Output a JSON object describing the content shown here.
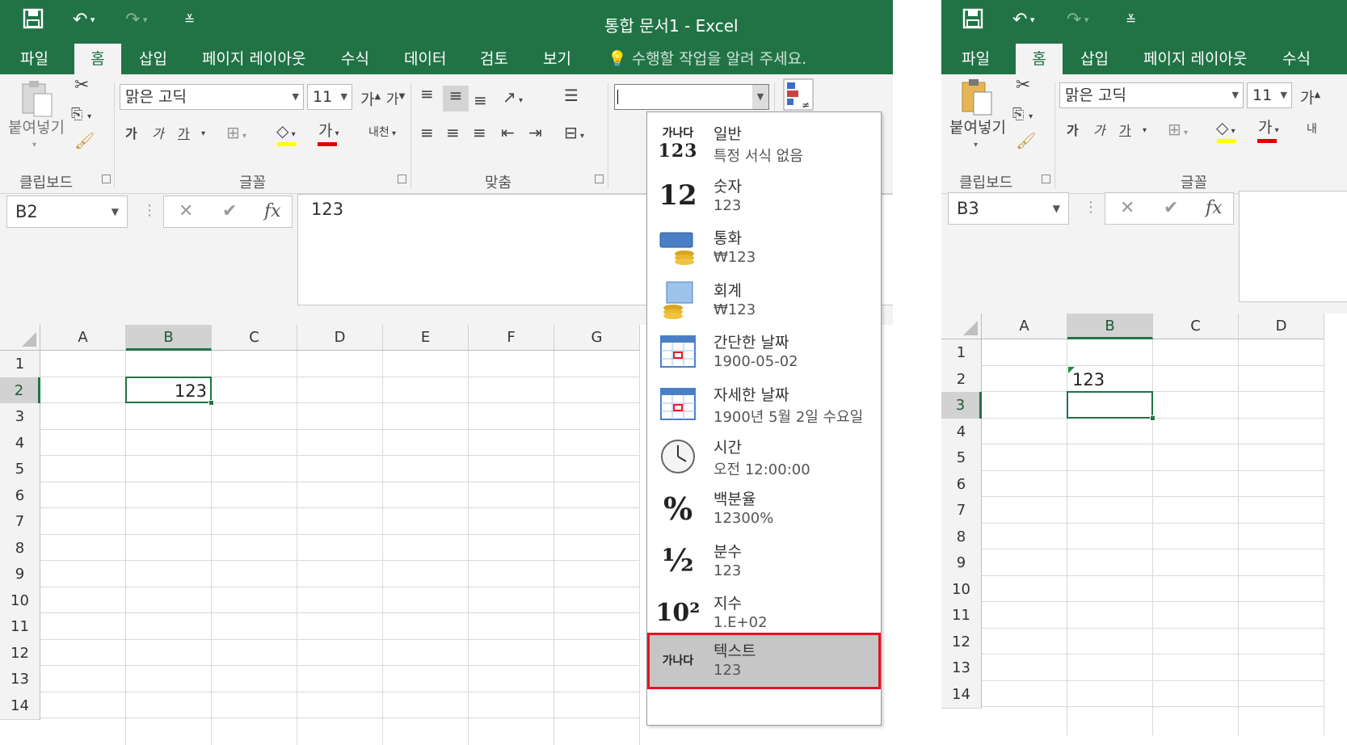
{
  "left": {
    "window_title": "통합 문서1 - Excel",
    "tabs": [
      "파일",
      "홈",
      "삽입",
      "페이지 레이아웃",
      "수식",
      "데이터",
      "검토",
      "보기"
    ],
    "tell_me": "수행할 작업을 알려 주세요.",
    "ribbon": {
      "paste_label": "붙여넣기",
      "font_name": "맑은 고딕",
      "font_size": "11",
      "bold": "가",
      "italic": "가",
      "underline": "가",
      "grow_font": "가",
      "shrink_font": "가",
      "font_color": "가",
      "wrap_text": "내천",
      "groups": {
        "clipboard": "클립보드",
        "font": "글꼴",
        "alignment": "맞춤"
      },
      "number_format_value": ""
    },
    "name_box": "B2",
    "formula": "123",
    "columns": [
      "A",
      "B",
      "C",
      "D",
      "E",
      "F",
      "G"
    ],
    "rows": [
      "1",
      "2",
      "3",
      "4",
      "5",
      "6",
      "7",
      "8",
      "9",
      "10",
      "11",
      "12",
      "13",
      "14"
    ],
    "cell_B2": "123",
    "number_formats": [
      {
        "name": "일반",
        "example": "특정 서식 없음",
        "icon": "general-icon",
        "icon_text": "가나다",
        "icon_text2": "123"
      },
      {
        "name": "숫자",
        "example": "123",
        "icon": "number-icon",
        "icon_text": "12"
      },
      {
        "name": "통화",
        "example": "₩123",
        "icon": "currency-icon"
      },
      {
        "name": "회계",
        "example": "₩123",
        "icon": "accounting-icon"
      },
      {
        "name": "간단한 날짜",
        "example": "1900-05-02",
        "icon": "short-date-icon"
      },
      {
        "name": "자세한 날짜",
        "example": "1900년 5월 2일 수요일",
        "icon": "long-date-icon"
      },
      {
        "name": "시간",
        "example": "오전 12:00:00",
        "icon": "clock-icon"
      },
      {
        "name": "백분율",
        "example": "12300%",
        "icon": "percent-icon",
        "icon_text": "%"
      },
      {
        "name": "분수",
        "example": "123",
        "icon": "fraction-icon",
        "icon_text": "½"
      },
      {
        "name": "지수",
        "example": "1.E+02",
        "icon": "scientific-icon",
        "icon_text": "10²"
      },
      {
        "name": "텍스트",
        "example": "123",
        "icon": "text-icon",
        "icon_text": "가나다"
      }
    ]
  },
  "right": {
    "tabs": [
      "파일",
      "홈",
      "삽입",
      "페이지 레이아웃",
      "수식"
    ],
    "ribbon": {
      "paste_label": "붙여넣기",
      "font_name": "맑은 고딕",
      "font_size": "11",
      "bold": "가",
      "italic": "가",
      "underline": "가",
      "grow_font": "가",
      "font_color": "가",
      "wrap_text": "내",
      "groups": {
        "clipboard": "클립보드",
        "font": "글꼴"
      }
    },
    "name_box": "B3",
    "columns": [
      "A",
      "B",
      "C",
      "D"
    ],
    "rows": [
      "1",
      "2",
      "3",
      "4",
      "5",
      "6",
      "7",
      "8",
      "9",
      "10",
      "11",
      "12",
      "13",
      "14"
    ],
    "cell_B2": "123"
  },
  "colors": {
    "excel_green": "#217346",
    "highlight_red": "#e81123"
  }
}
